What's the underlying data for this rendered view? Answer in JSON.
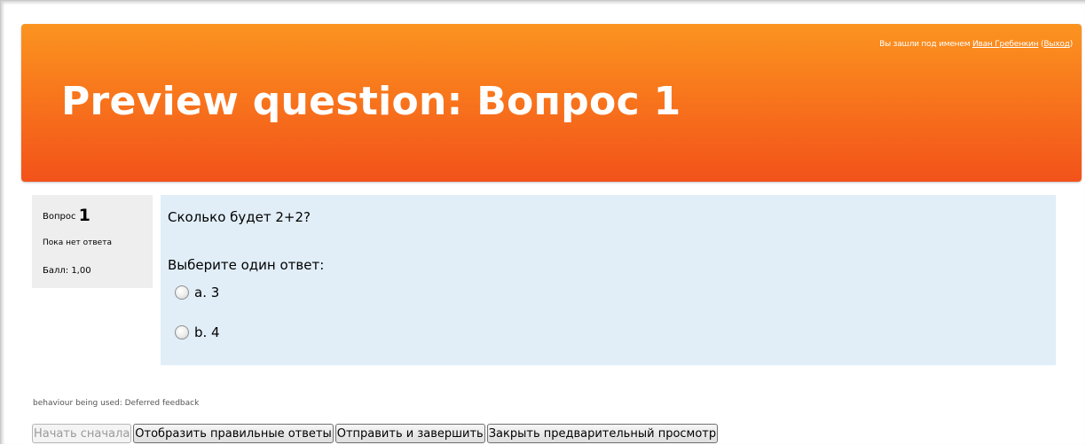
{
  "header": {
    "login_prefix": "Вы зашли под именем ",
    "user_name": "Иван Гребенкин",
    "paren_open": " (",
    "logout": "Выход",
    "paren_close": ")",
    "title": "Preview question: Вопрос 1"
  },
  "info": {
    "question_label": "Вопрос ",
    "question_number": "1",
    "state": "Пока нет ответа",
    "grade": "Балл: 1,00"
  },
  "question": {
    "text": "Сколько будет 2+2?",
    "prompt": "Выберите один ответ:",
    "answers": [
      {
        "label": "a. 3",
        "selected": false
      },
      {
        "label": "b. 4",
        "selected": false
      }
    ]
  },
  "behaviour": "behaviour being used: Deferred feedback",
  "buttons": {
    "restart": "Начать сначала",
    "fill_correct": "Отобразить правильные ответы",
    "submit_finish": "Отправить и завершить",
    "close_preview": "Закрыть предварительный просмотр"
  },
  "colors": {
    "header_top": "#fb9420",
    "header_bottom": "#f2521a",
    "info_bg": "#eeeeee",
    "content_bg": "#e1eef8"
  }
}
